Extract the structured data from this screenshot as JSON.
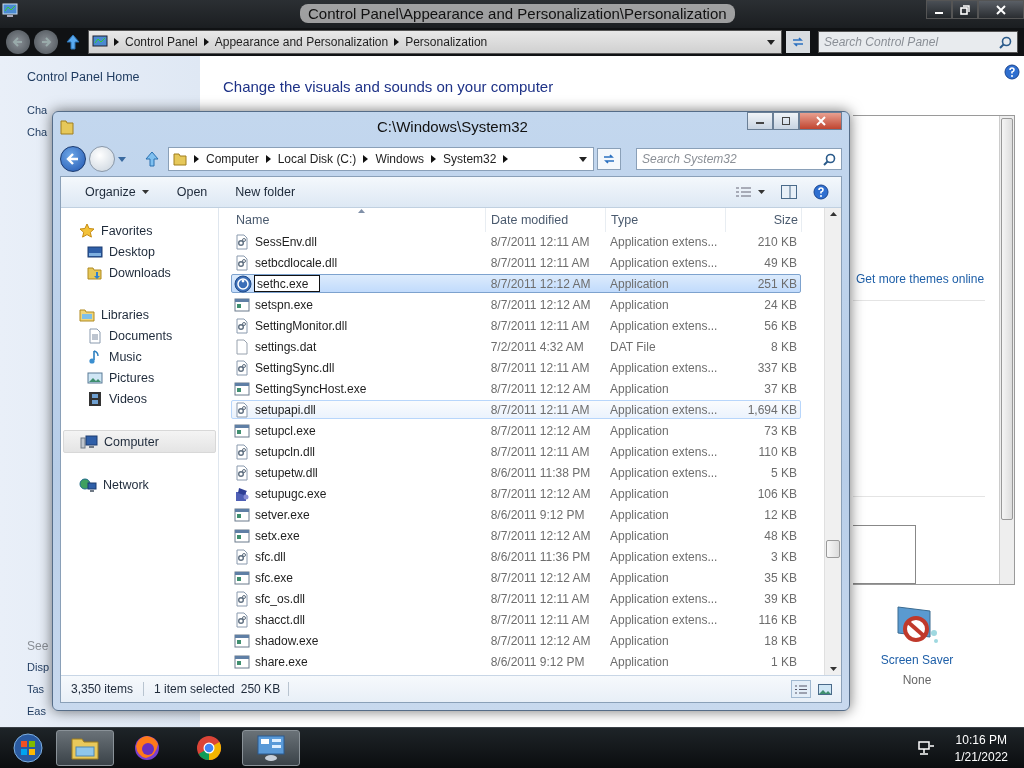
{
  "control_panel": {
    "title": "Control Panel\\Appearance and Personalization\\Personalization",
    "breadcrumb": [
      "Control Panel",
      "Appearance and Personalization",
      "Personalization"
    ],
    "search": {
      "placeholder": "Search Control Panel"
    },
    "sidebar": {
      "home": "Control Panel Home",
      "links": [
        "Cha",
        "Cha"
      ],
      "see_also_heading": "See",
      "see_also": [
        "Disp",
        "Tas",
        "Eas"
      ]
    },
    "heading": "Change the visuals and sounds on your computer",
    "themes_link": "Get more themes online",
    "screen_saver": {
      "label": "Screen Saver",
      "value": "None"
    }
  },
  "explorer": {
    "title": "C:\\Windows\\System32",
    "breadcrumb": [
      "Computer",
      "Local Disk (C:)",
      "Windows",
      "System32"
    ],
    "search": {
      "placeholder": "Search System32"
    },
    "toolbar": [
      {
        "label": "Organize",
        "dropdown": true
      },
      {
        "label": "Open",
        "dropdown": false
      },
      {
        "label": "New folder",
        "dropdown": false
      }
    ],
    "nav": [
      {
        "label": "Favorites",
        "kind": "star",
        "selected": false,
        "children": [
          {
            "label": "Desktop",
            "kind": "desktop",
            "selected": false
          },
          {
            "label": "Downloads",
            "kind": "downloads",
            "selected": false
          }
        ]
      },
      {
        "label": "Libraries",
        "kind": "libraries",
        "selected": false,
        "children": [
          {
            "label": "Documents",
            "kind": "documents",
            "selected": false
          },
          {
            "label": "Music",
            "kind": "music",
            "selected": false
          },
          {
            "label": "Pictures",
            "kind": "pictures",
            "selected": false
          },
          {
            "label": "Videos",
            "kind": "videos",
            "selected": false
          }
        ]
      },
      {
        "label": "Computer",
        "kind": "computer",
        "selected": true
      },
      {
        "label": "Network",
        "kind": "network",
        "selected": false
      }
    ],
    "columns": [
      {
        "label": "Name",
        "sorted": true
      },
      {
        "label": "Date modified",
        "sorted": false
      },
      {
        "label": "Type",
        "sorted": false
      },
      {
        "label": "Size",
        "sorted": false
      }
    ],
    "rows": [
      {
        "name": "SessEnv.dll",
        "date": "8/7/2011 12:11 AM",
        "type": "Application extens...",
        "size": "210 KB",
        "kind": "dll",
        "selected": false,
        "hovered": false,
        "renaming": false
      },
      {
        "name": "setbcdlocale.dll",
        "date": "8/7/2011 12:11 AM",
        "type": "Application extens...",
        "size": "49 KB",
        "kind": "dll",
        "selected": false,
        "hovered": false,
        "renaming": false
      },
      {
        "name": "sethc.exe",
        "date": "8/7/2011 12:12 AM",
        "type": "Application",
        "size": "251 KB",
        "kind": "accessibility",
        "selected": true,
        "hovered": false,
        "renaming": true
      },
      {
        "name": "setspn.exe",
        "date": "8/7/2011 12:12 AM",
        "type": "Application",
        "size": "24 KB",
        "kind": "exe",
        "selected": false,
        "hovered": false,
        "renaming": false
      },
      {
        "name": "SettingMonitor.dll",
        "date": "8/7/2011 12:11 AM",
        "type": "Application extens...",
        "size": "56 KB",
        "kind": "dll",
        "selected": false,
        "hovered": false,
        "renaming": false
      },
      {
        "name": "settings.dat",
        "date": "7/2/2011 4:32 AM",
        "type": "DAT File",
        "size": "8 KB",
        "kind": "file",
        "selected": false,
        "hovered": false,
        "renaming": false
      },
      {
        "name": "SettingSync.dll",
        "date": "8/7/2011 12:11 AM",
        "type": "Application extens...",
        "size": "337 KB",
        "kind": "dll",
        "selected": false,
        "hovered": false,
        "renaming": false
      },
      {
        "name": "SettingSyncHost.exe",
        "date": "8/7/2011 12:12 AM",
        "type": "Application",
        "size": "37 KB",
        "kind": "exe",
        "selected": false,
        "hovered": false,
        "renaming": false
      },
      {
        "name": "setupapi.dll",
        "date": "8/7/2011 12:11 AM",
        "type": "Application extens...",
        "size": "1,694 KB",
        "kind": "dll",
        "selected": false,
        "hovered": true,
        "renaming": false
      },
      {
        "name": "setupcl.exe",
        "date": "8/7/2011 12:12 AM",
        "type": "Application",
        "size": "73 KB",
        "kind": "exe",
        "selected": false,
        "hovered": false,
        "renaming": false
      },
      {
        "name": "setupcln.dll",
        "date": "8/7/2011 12:11 AM",
        "type": "Application extens...",
        "size": "110 KB",
        "kind": "dll",
        "selected": false,
        "hovered": false,
        "renaming": false
      },
      {
        "name": "setupetw.dll",
        "date": "8/6/2011 11:38 PM",
        "type": "Application extens...",
        "size": "5 KB",
        "kind": "dll",
        "selected": false,
        "hovered": false,
        "renaming": false
      },
      {
        "name": "setupugc.exe",
        "date": "8/7/2011 12:12 AM",
        "type": "Application",
        "size": "106 KB",
        "kind": "setup",
        "selected": false,
        "hovered": false,
        "renaming": false
      },
      {
        "name": "setver.exe",
        "date": "8/6/2011 9:12 PM",
        "type": "Application",
        "size": "12 KB",
        "kind": "exe",
        "selected": false,
        "hovered": false,
        "renaming": false
      },
      {
        "name": "setx.exe",
        "date": "8/7/2011 12:12 AM",
        "type": "Application",
        "size": "48 KB",
        "kind": "exe",
        "selected": false,
        "hovered": false,
        "renaming": false
      },
      {
        "name": "sfc.dll",
        "date": "8/6/2011 11:36 PM",
        "type": "Application extens...",
        "size": "3 KB",
        "kind": "dll",
        "selected": false,
        "hovered": false,
        "renaming": false
      },
      {
        "name": "sfc.exe",
        "date": "8/7/2011 12:12 AM",
        "type": "Application",
        "size": "35 KB",
        "kind": "exe",
        "selected": false,
        "hovered": false,
        "renaming": false
      },
      {
        "name": "sfc_os.dll",
        "date": "8/7/2011 12:11 AM",
        "type": "Application extens...",
        "size": "39 KB",
        "kind": "dll",
        "selected": false,
        "hovered": false,
        "renaming": false
      },
      {
        "name": "shacct.dll",
        "date": "8/7/2011 12:11 AM",
        "type": "Application extens...",
        "size": "116 KB",
        "kind": "dll",
        "selected": false,
        "hovered": false,
        "renaming": false
      },
      {
        "name": "shadow.exe",
        "date": "8/7/2011 12:12 AM",
        "type": "Application",
        "size": "18 KB",
        "kind": "exe",
        "selected": false,
        "hovered": false,
        "renaming": false
      },
      {
        "name": "share.exe",
        "date": "8/6/2011 9:12 PM",
        "type": "Application",
        "size": "1 KB",
        "kind": "exe",
        "selected": false,
        "hovered": false,
        "renaming": false
      }
    ],
    "status": {
      "count": "3,350 items",
      "selection": "1 item selected",
      "selection_size": "250 KB"
    }
  },
  "taskbar": {
    "apps": [
      {
        "kind": "explorer",
        "active": true
      },
      {
        "kind": "firefox",
        "active": false
      },
      {
        "kind": "chrome",
        "active": false
      },
      {
        "kind": "control-panel",
        "active": true
      }
    ],
    "clock": {
      "time": "10:16 PM",
      "date": "1/21/2022"
    }
  }
}
